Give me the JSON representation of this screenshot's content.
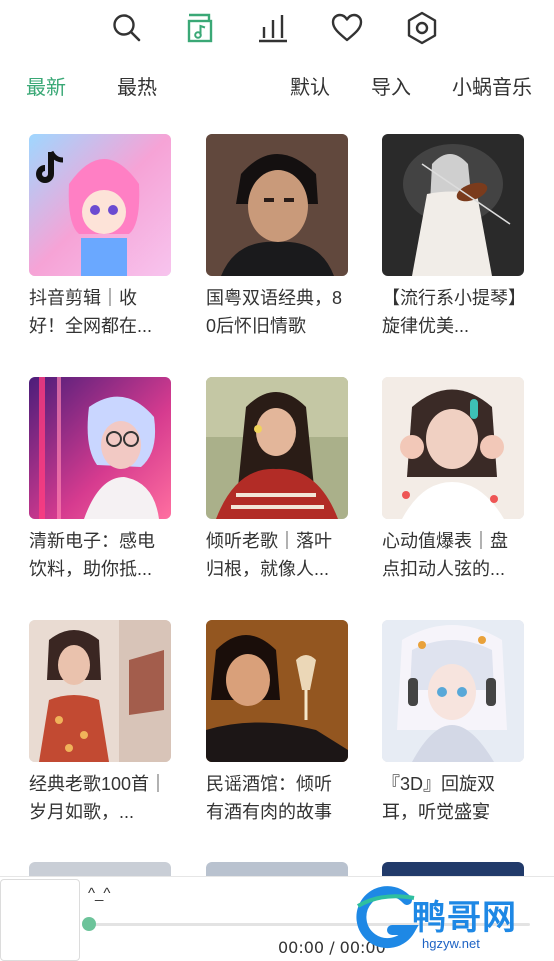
{
  "toolbar": {
    "icons": [
      "search-icon",
      "music-library-icon",
      "chart-icon",
      "heart-icon",
      "settings-icon"
    ],
    "active_icon": "music-library-icon"
  },
  "tabs": {
    "latest": "最新",
    "hottest": "最热",
    "default": "默认",
    "import": "导入",
    "source": "小蜗音乐"
  },
  "playlists": [
    {
      "title": "抖音剪辑｜收好！全网都在...",
      "cover": "anime-girl-pink"
    },
    {
      "title": "国粤双语经典，80后怀旧情歌",
      "cover": "man-portrait"
    },
    {
      "title": "【流行系小提琴】旋律优美...",
      "cover": "violin-girl"
    },
    {
      "title": "清新电子：感电饮料，助你抵...",
      "cover": "neon-girl"
    },
    {
      "title": "倾听老歌｜落叶归根，就像人...",
      "cover": "girl-red-sweater"
    },
    {
      "title": "心动值爆表｜盘点扣动人弦的...",
      "cover": "girl-hands"
    },
    {
      "title": "经典老歌100首｜岁月如歌，...",
      "cover": "girl-floral-dress"
    },
    {
      "title": "民谣酒馆：倾听有酒有肉的故事",
      "cover": "girl-wine-glass"
    },
    {
      "title": "『3D』回旋双耳，听觉盛宴",
      "cover": "anime-headphones"
    }
  ],
  "player": {
    "title": "^_^",
    "time": "00:00 / 00:00",
    "progress": 0
  },
  "watermark": {
    "text": "鸭哥网",
    "url": "hgzyw.net"
  },
  "colors": {
    "accent": "#3aa876",
    "text": "#333333"
  }
}
